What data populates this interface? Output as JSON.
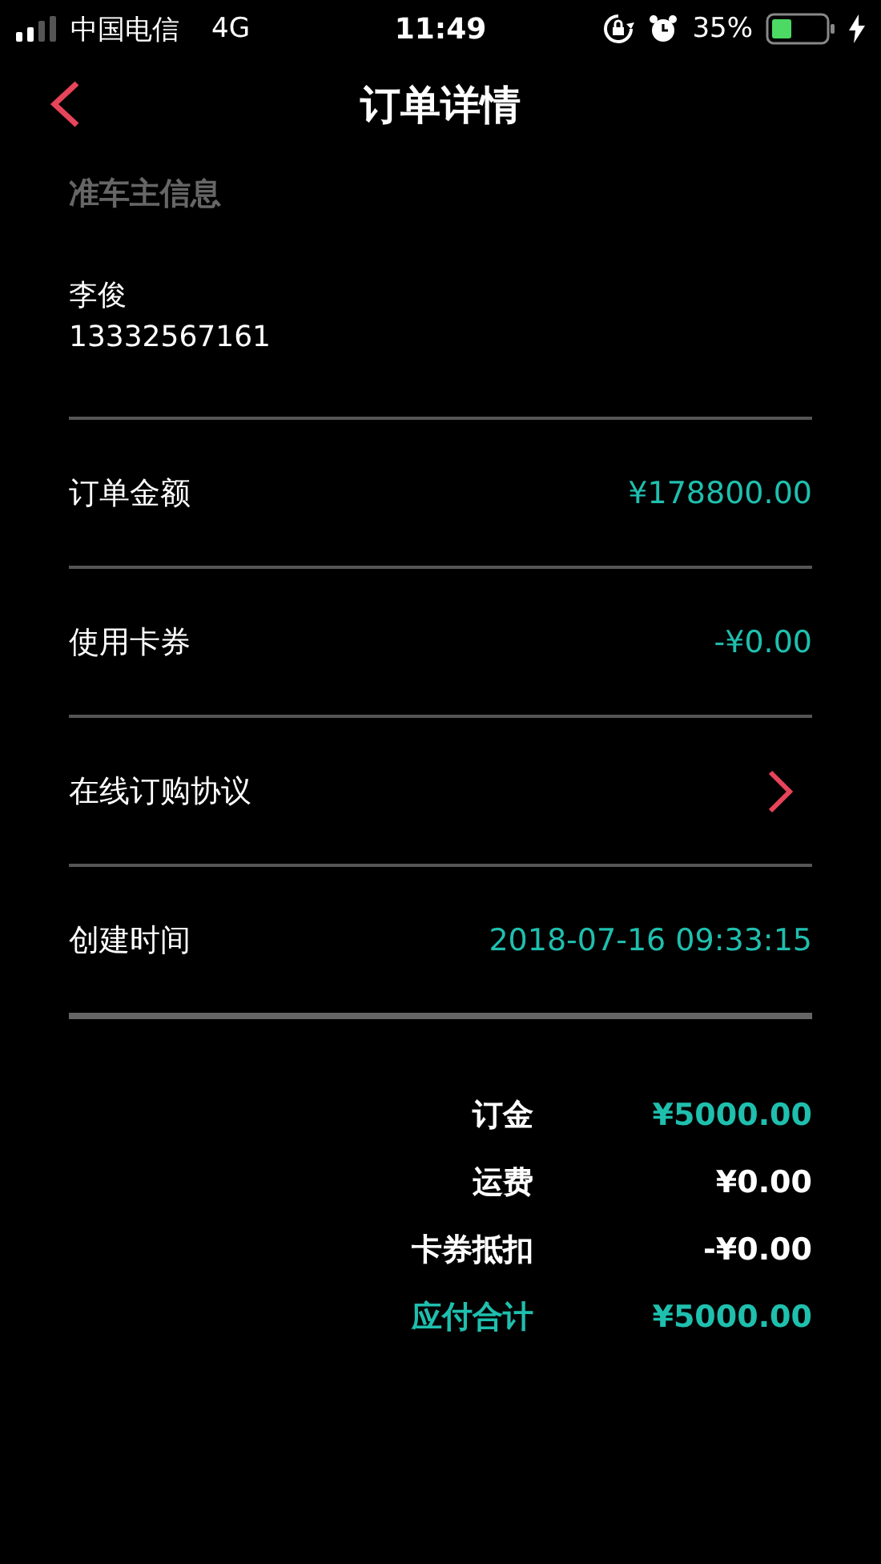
{
  "status_bar": {
    "carrier": "中国电信",
    "network": "4G",
    "time": "11:49",
    "battery": "35%"
  },
  "header": {
    "title": "订单详情"
  },
  "owner": {
    "section_title": "准车主信息",
    "name": "李俊",
    "phone": "13332567161"
  },
  "rows": [
    {
      "kind": "value",
      "label": "订单金额",
      "value": "¥178800.00"
    },
    {
      "kind": "value",
      "label": "使用卡券",
      "value": "-¥0.00"
    },
    {
      "kind": "link",
      "label": "在线订购协议"
    },
    {
      "kind": "value",
      "label": "创建时间",
      "value": "2018-07-16 09:33:15"
    }
  ],
  "summary": [
    {
      "kind": "accent_value",
      "label": "订金",
      "value": "¥5000.00"
    },
    {
      "kind": "plain",
      "label": "运费",
      "value": "¥0.00"
    },
    {
      "kind": "plain",
      "label": "卡券抵扣",
      "value": "-¥0.00"
    },
    {
      "kind": "total",
      "label": "应付合计",
      "value": "¥5000.00"
    }
  ]
}
